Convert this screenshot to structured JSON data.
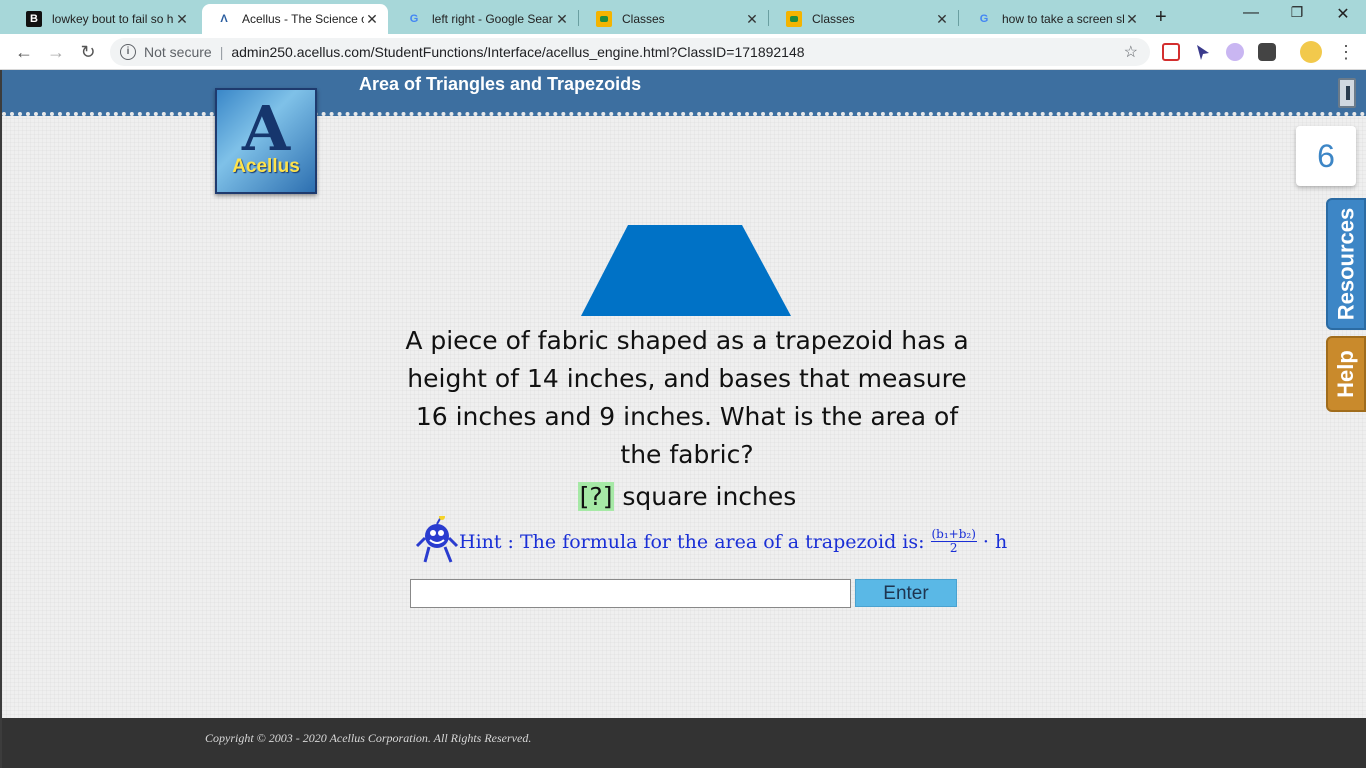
{
  "browser": {
    "tabs": [
      {
        "title": "lowkey bout to fail so h",
        "favicon": "b-icon",
        "close": "✕"
      },
      {
        "title": "Acellus - The Science of",
        "favicon": "acellus-icon",
        "close": "✕"
      },
      {
        "title": "left right - Google Sear",
        "favicon": "google-icon",
        "close": "✕"
      },
      {
        "title": "Classes",
        "favicon": "classroom-icon",
        "close": "✕"
      },
      {
        "title": "Classes",
        "favicon": "classroom-icon",
        "close": "✕"
      },
      {
        "title": "how to take a screen sh",
        "favicon": "google-icon",
        "close": "✕"
      }
    ],
    "security_label": "Not secure",
    "url": "admin250.acellus.com/StudentFunctions/Interface/acellus_engine.html?ClassID=171892148"
  },
  "lesson": {
    "title": "Area of Triangles and Trapezoids",
    "logo_text": "Acellus",
    "logo_letter": "A"
  },
  "sidebar": {
    "counter": "6",
    "resources_label": "Resources",
    "help_label": "Help"
  },
  "problem": {
    "question": "A piece of fabric shaped as a trapezoid has a height of 14 inches, and bases that measure 16 inches and 9 inches. What is the area of the fabric?",
    "placeholder": "[?]",
    "unit": " square inches",
    "hint_prefix": "Hint : The formula for the area of a trapezoid is:",
    "hint_numerator": "(b₁+b₂)",
    "hint_denominator": "2",
    "hint_suffix": "· h",
    "shape_color": "#0072c6"
  },
  "answer": {
    "value": "",
    "button_label": "Enter"
  },
  "footer": {
    "copyright": "Copyright © 2003 - 2020 Acellus Corporation.  All Rights Reserved."
  }
}
